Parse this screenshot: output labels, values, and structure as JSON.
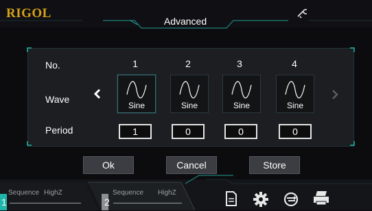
{
  "header": {
    "logo": "RIGOL",
    "title": "Advanced",
    "usb_icon": "usb-icon"
  },
  "table": {
    "labels": {
      "no": "No.",
      "wave": "Wave",
      "period": "Period"
    },
    "columns": [
      {
        "no": "1",
        "wave": "Sine",
        "period": "1",
        "selected": true
      },
      {
        "no": "2",
        "wave": "Sine",
        "period": "0",
        "selected": false
      },
      {
        "no": "3",
        "wave": "Sine",
        "period": "0",
        "selected": false
      },
      {
        "no": "4",
        "wave": "Sine",
        "period": "0",
        "selected": false
      }
    ]
  },
  "buttons": {
    "ok": "Ok",
    "cancel": "Cancel",
    "store": "Store"
  },
  "channels": [
    {
      "number": "1",
      "mode": "Sequence",
      "impedance": "HighZ"
    },
    {
      "number": "2",
      "mode": "Sequence",
      "impedance": "HighZ"
    }
  ],
  "colors": {
    "accent": "#1fb5a8",
    "logo": "#d6a21a",
    "ch1": "#1fb5a8",
    "ch2": "#8c8f93"
  }
}
